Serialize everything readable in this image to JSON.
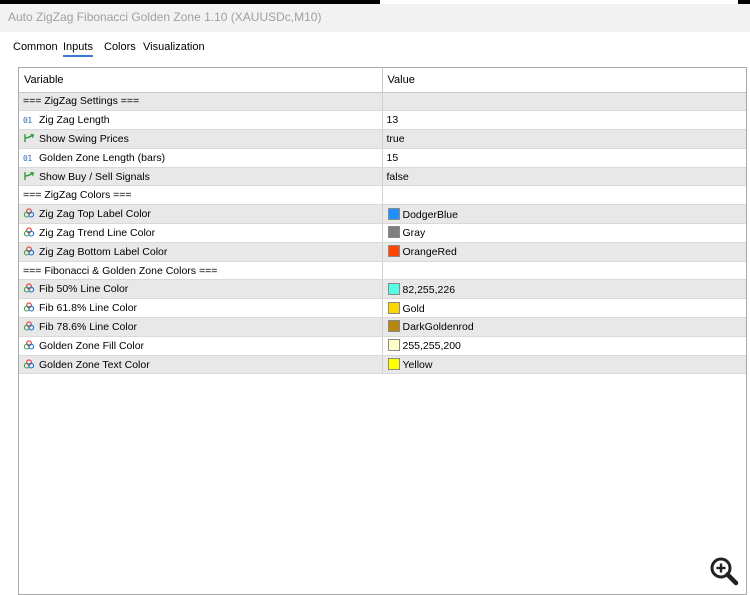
{
  "window": {
    "title": "Auto ZigZag Fibonacci Golden Zone 1.10 (XAUUSDc,M10)"
  },
  "tabs": [
    {
      "label": "Common",
      "active": false
    },
    {
      "label": "Inputs",
      "active": true
    },
    {
      "label": "Colors",
      "active": false
    },
    {
      "label": "Visualization",
      "active": false
    }
  ],
  "table": {
    "headers": {
      "variable": "Variable",
      "value": "Value"
    },
    "rows": [
      {
        "variable": "=== ZigZag Settings ===",
        "value": "",
        "icon": "none"
      },
      {
        "variable": "Zig Zag Length",
        "value": "13",
        "icon": "integer-icon"
      },
      {
        "variable": "Show Swing Prices",
        "value": "true",
        "icon": "bool-icon"
      },
      {
        "variable": "Golden Zone Length (bars)",
        "value": "15",
        "icon": "integer-icon"
      },
      {
        "variable": "Show Buy / Sell Signals",
        "value": "false",
        "icon": "bool-icon"
      },
      {
        "variable": "=== ZigZag Colors ===",
        "value": "",
        "icon": "none"
      },
      {
        "variable": "Zig Zag Top Label Color",
        "value": "DodgerBlue",
        "icon": "color-icon",
        "swatch": "#1e90ff"
      },
      {
        "variable": "Zig Zag Trend Line Color",
        "value": "Gray",
        "icon": "color-icon",
        "swatch": "#808080"
      },
      {
        "variable": "Zig Zag Bottom Label Color",
        "value": "OrangeRed",
        "icon": "color-icon",
        "swatch": "#ff4500"
      },
      {
        "variable": "=== Fibonacci & Golden Zone Colors ===",
        "value": "",
        "icon": "none"
      },
      {
        "variable": "Fib 50% Line Color",
        "value": "82,255,226",
        "icon": "color-icon",
        "swatch": "#52ffe2"
      },
      {
        "variable": "Fib 61.8% Line Color",
        "value": "Gold",
        "icon": "color-icon",
        "swatch": "#ffd700"
      },
      {
        "variable": "Fib 78.6% Line Color",
        "value": "DarkGoldenrod",
        "icon": "color-icon",
        "swatch": "#b8860b"
      },
      {
        "variable": "Golden Zone Fill Color",
        "value": "255,255,200",
        "icon": "color-icon",
        "swatch": "#ffffc8"
      },
      {
        "variable": "Golden Zone Text Color",
        "value": "Yellow",
        "icon": "color-icon",
        "swatch": "#ffff00"
      }
    ]
  },
  "icons": {
    "zoom": "zoom-in-icon"
  }
}
